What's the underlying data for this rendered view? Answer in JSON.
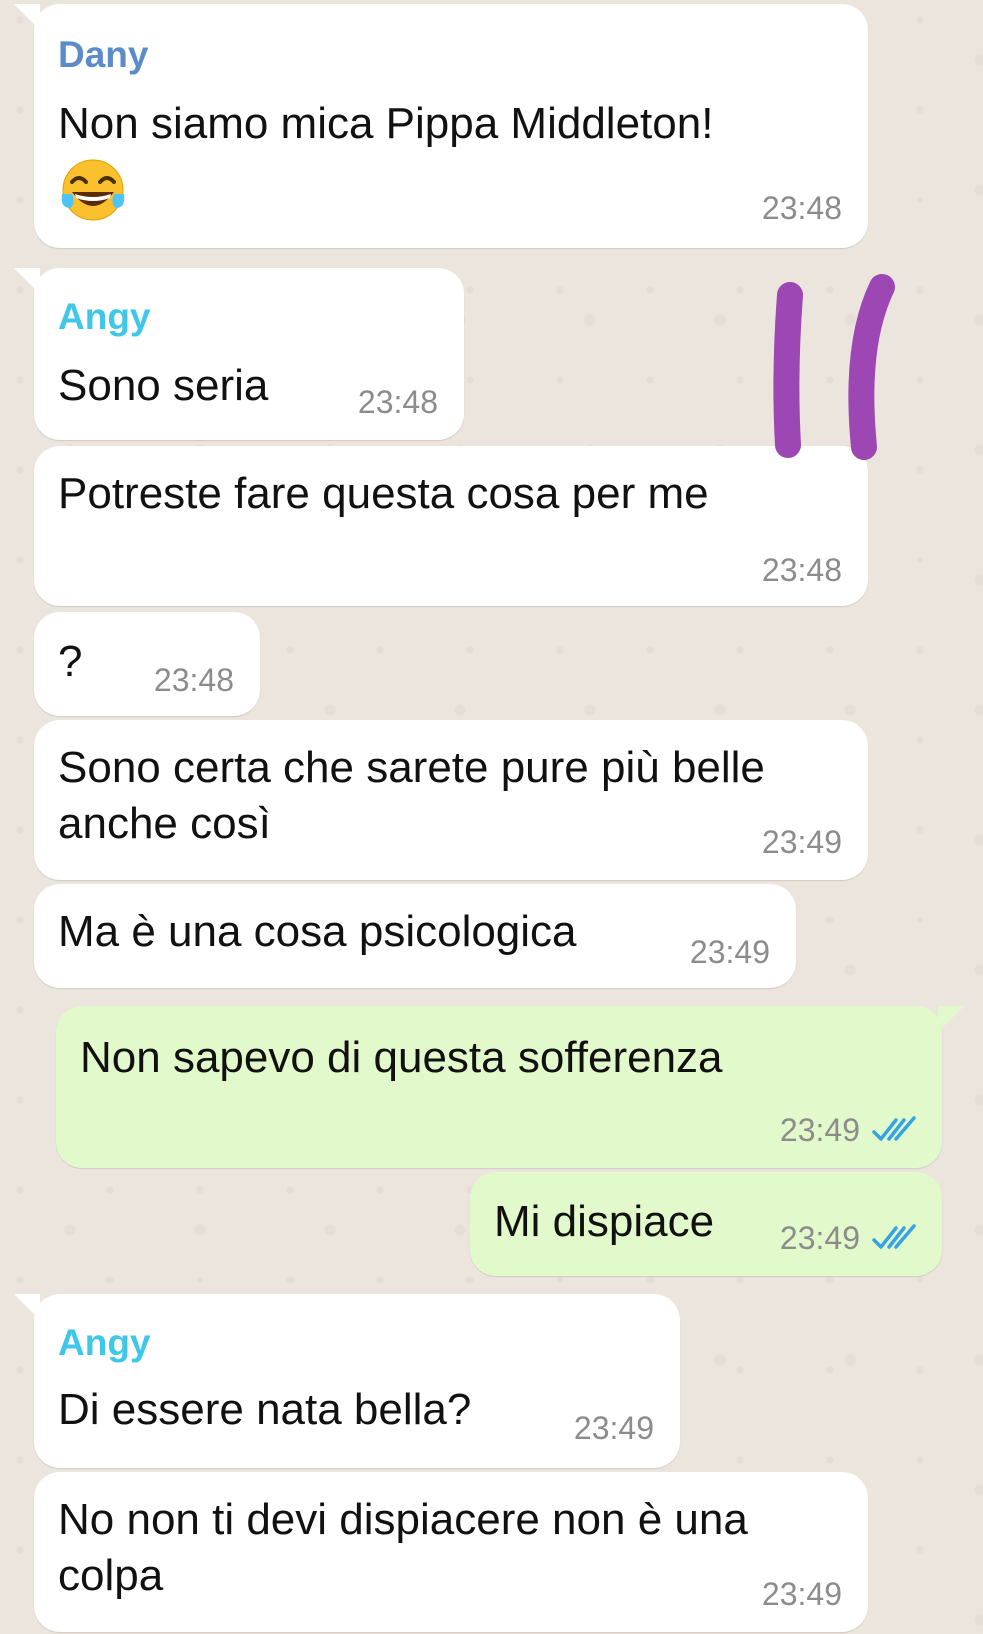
{
  "colors": {
    "sender_dany": "#5b8bc9",
    "sender_angy": "#3ec7e9",
    "incoming_bubble": "#ffffff",
    "outgoing_bubble": "#e2f9cc",
    "read_ticks": "#34a4e2",
    "scribble": "#9c47b3"
  },
  "messages": [
    {
      "sender": "Dany",
      "text": "Non siamo mica Pippa Middleton!",
      "emoji": "face-with-tears-of-joy",
      "time": "23:48"
    },
    {
      "sender": "Angy",
      "text": "Sono seria",
      "time": "23:48"
    },
    {
      "text": "Potreste fare questa cosa per me",
      "time": "23:48"
    },
    {
      "text": "?",
      "time": "23:48"
    },
    {
      "text_line1": "Sono certa che sarete pure più belle",
      "text_line2": "anche così",
      "time": "23:49"
    },
    {
      "text": "Ma è una cosa psicologica",
      "time": "23:49"
    },
    {
      "text": "Non sapevo di questa sofferenza",
      "time": "23:49",
      "status": "read"
    },
    {
      "text": "Mi dispiace",
      "time": "23:49",
      "status": "read"
    },
    {
      "sender": "Angy",
      "text": "Di essere nata bella?",
      "time": "23:49"
    },
    {
      "text_line1": "No non ti devi dispiacere non è una",
      "text_line2": "colpa",
      "time": "23:49"
    }
  ]
}
